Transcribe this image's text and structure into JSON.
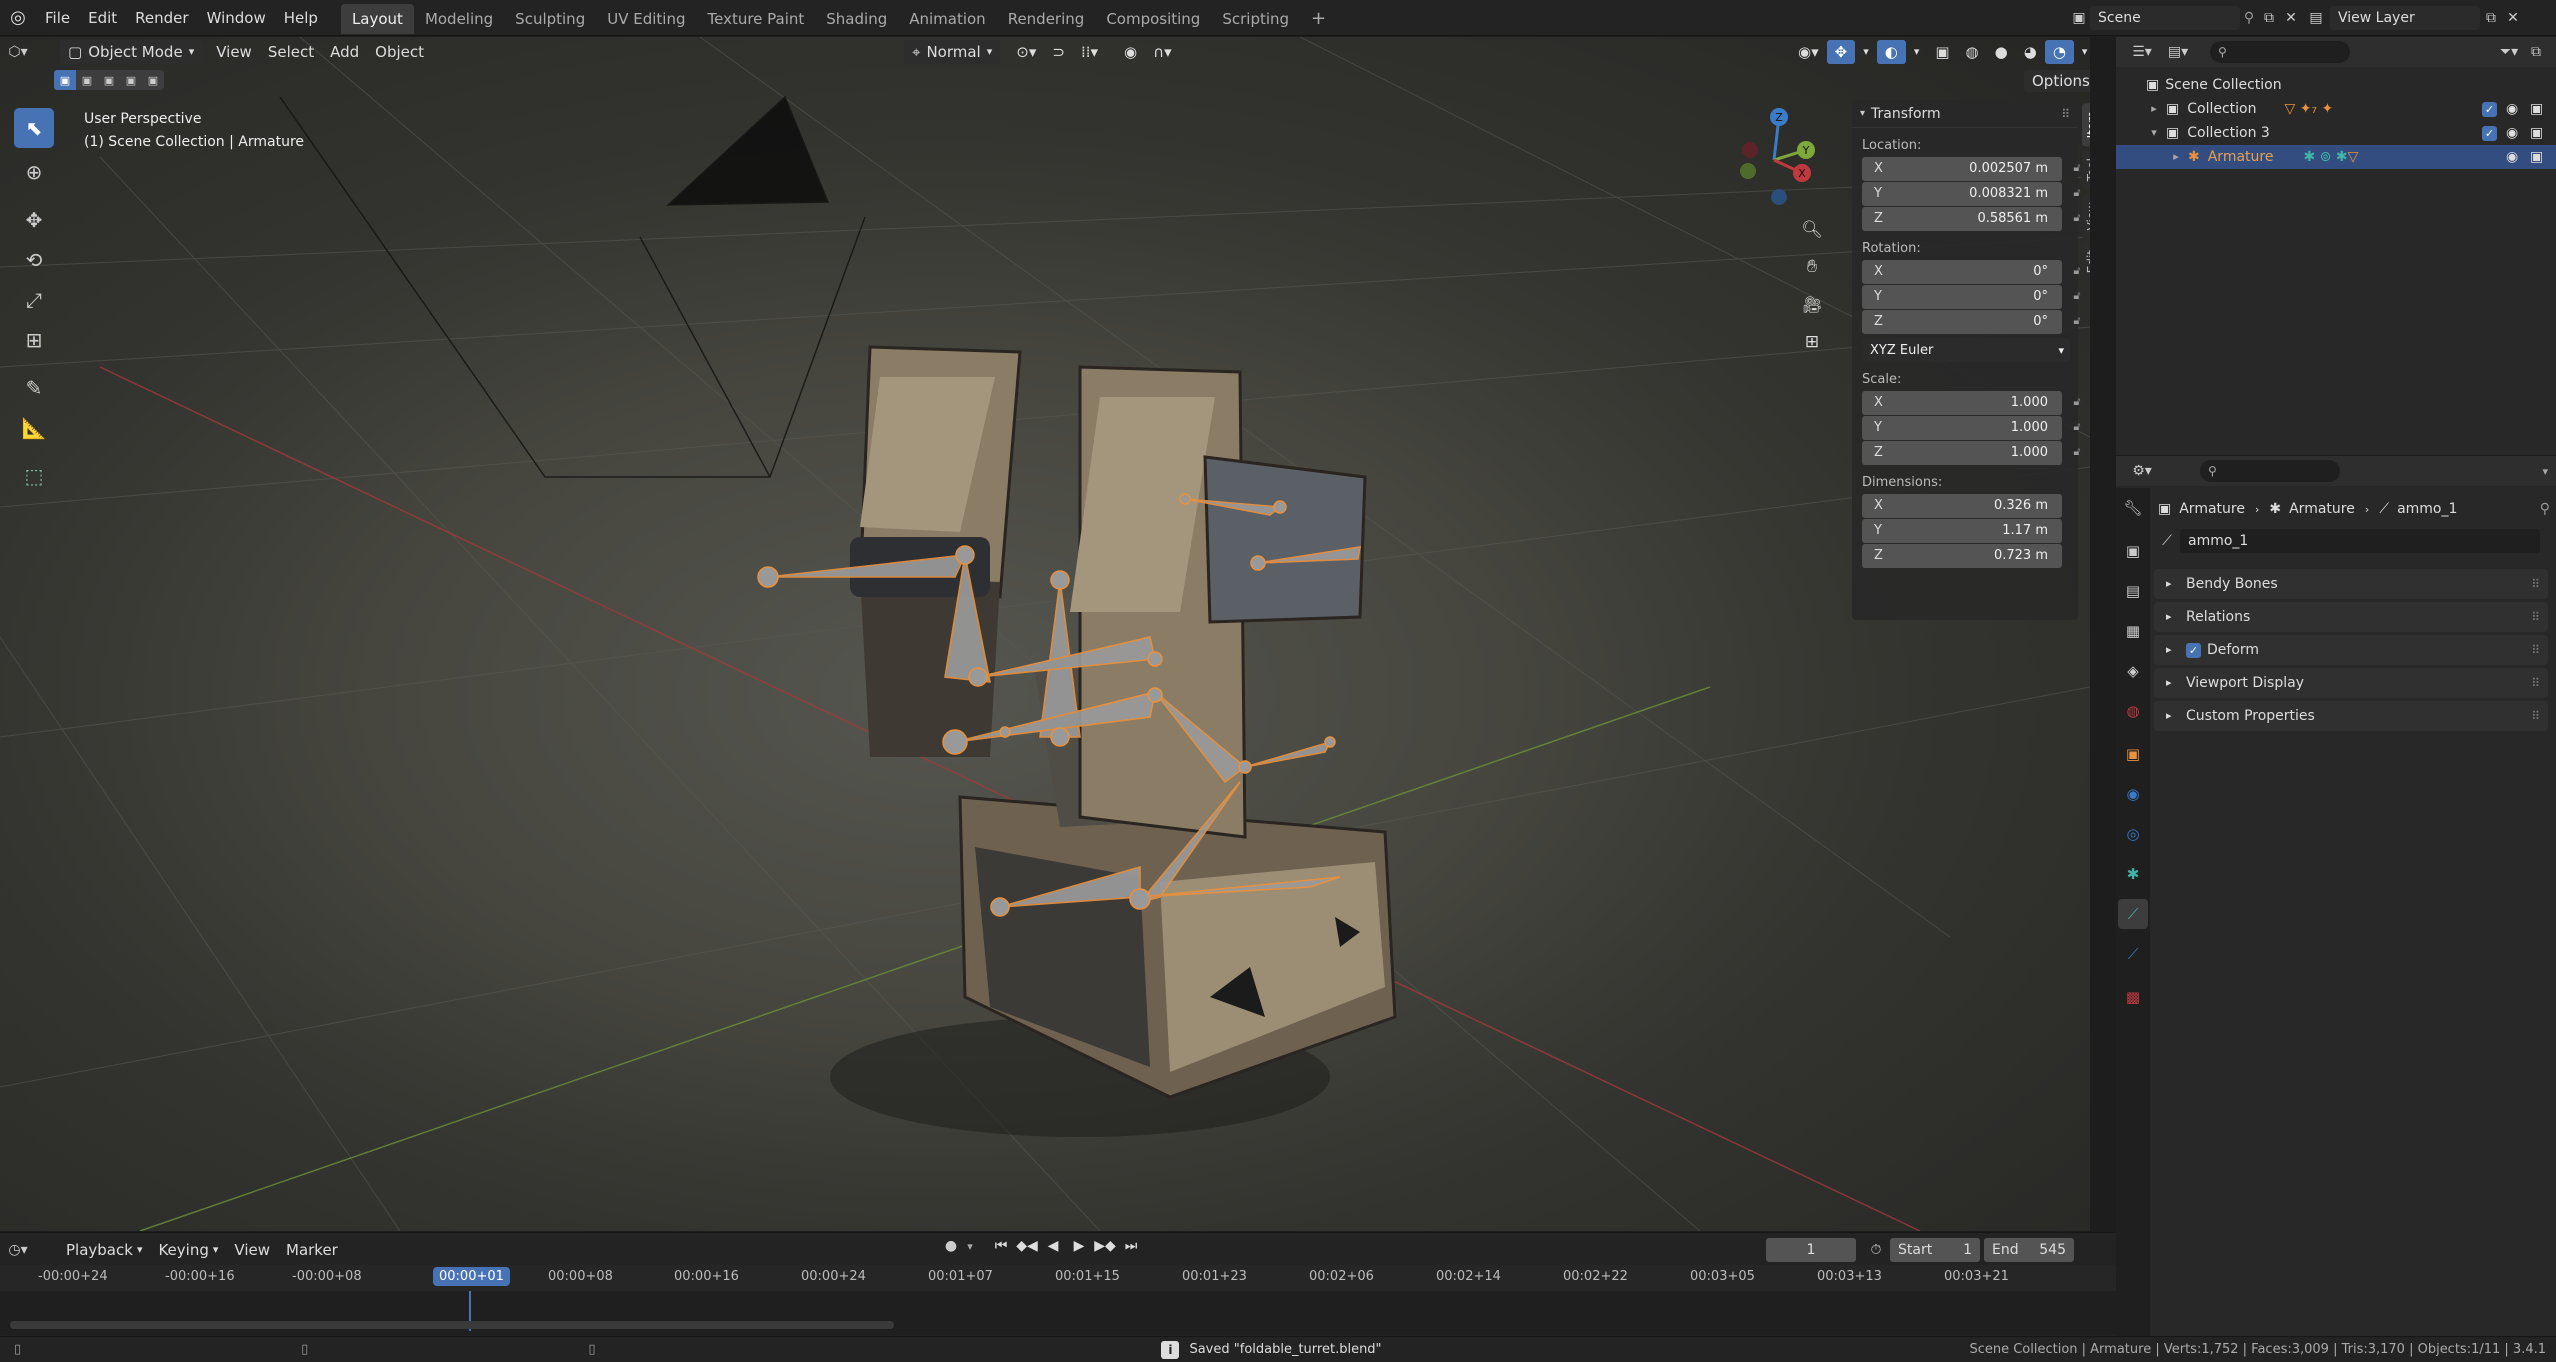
{
  "topbar": {
    "menus": [
      "File",
      "Edit",
      "Render",
      "Window",
      "Help"
    ],
    "workspaces": [
      "Layout",
      "Modeling",
      "Sculpting",
      "UV Editing",
      "Texture Paint",
      "Shading",
      "Animation",
      "Rendering",
      "Compositing",
      "Scripting"
    ],
    "active_workspace": "Layout",
    "add_tab": "+",
    "scene": "Scene",
    "view_layer": "View Layer"
  },
  "viewport": {
    "mode": "Object Mode",
    "menus": [
      "View",
      "Select",
      "Add",
      "Object"
    ],
    "orientation": "Normal",
    "options": "Options",
    "perspective": "User Perspective",
    "context": "(1) Scene Collection | Armature"
  },
  "gizmo": {
    "x": "X",
    "y": "Y",
    "z": "Z"
  },
  "npanel": {
    "title": "Transform",
    "location_label": "Location:",
    "location": [
      {
        "axis": "X",
        "value": "0.002507 m"
      },
      {
        "axis": "Y",
        "value": "0.008321 m"
      },
      {
        "axis": "Z",
        "value": "0.58561 m"
      }
    ],
    "rotation_label": "Rotation:",
    "rotation": [
      {
        "axis": "X",
        "value": "0°"
      },
      {
        "axis": "Y",
        "value": "0°"
      },
      {
        "axis": "Z",
        "value": "0°"
      }
    ],
    "rotation_mode": "XYZ Euler",
    "scale_label": "Scale:",
    "scale": [
      {
        "axis": "X",
        "value": "1.000"
      },
      {
        "axis": "Y",
        "value": "1.000"
      },
      {
        "axis": "Z",
        "value": "1.000"
      }
    ],
    "dimensions_label": "Dimensions:",
    "dimensions": [
      {
        "axis": "X",
        "value": "0.326 m"
      },
      {
        "axis": "Y",
        "value": "1.17 m"
      },
      {
        "axis": "Z",
        "value": "0.723 m"
      }
    ],
    "tabs": [
      "Item",
      "Tool",
      "View",
      "Edit"
    ]
  },
  "outliner": {
    "root": "Scene Collection",
    "items": [
      "Collection",
      "Collection 3",
      "Armature"
    ]
  },
  "properties": {
    "breadcrumb": [
      "Armature",
      "Armature",
      "ammo_1"
    ],
    "bone_name": "ammo_1",
    "panels": [
      "Bendy Bones",
      "Relations",
      "Deform",
      "Viewport Display",
      "Custom Properties"
    ]
  },
  "timeline": {
    "menus": [
      "Playback",
      "Keying",
      "View",
      "Marker"
    ],
    "current_frame": "1",
    "start_label": "Start",
    "start": "1",
    "end_label": "End",
    "end": "545",
    "ticks": [
      "-00:00+24",
      "-00:00+16",
      "-00:00+08",
      "00:00+01",
      "00:00+08",
      "00:00+16",
      "00:00+24",
      "00:01+07",
      "00:01+15",
      "00:01+23",
      "00:02+06",
      "00:02+14",
      "00:02+22",
      "00:03+05",
      "00:03+13",
      "00:03+21"
    ]
  },
  "status": {
    "message": "Saved \"foldable_turret.blend\"",
    "stats": "Scene Collection | Armature | Verts:1,752 | Faces:3,009 | Tris:3,170 | Objects:1/11 | 3.4.1"
  },
  "colors": {
    "accent": "#4772b3",
    "selected_row": "#334d80",
    "bone_outline": "#e8913e",
    "axis_x": "#c0393f",
    "axis_y": "#7fa83a",
    "axis_z": "#3a7cc9"
  }
}
